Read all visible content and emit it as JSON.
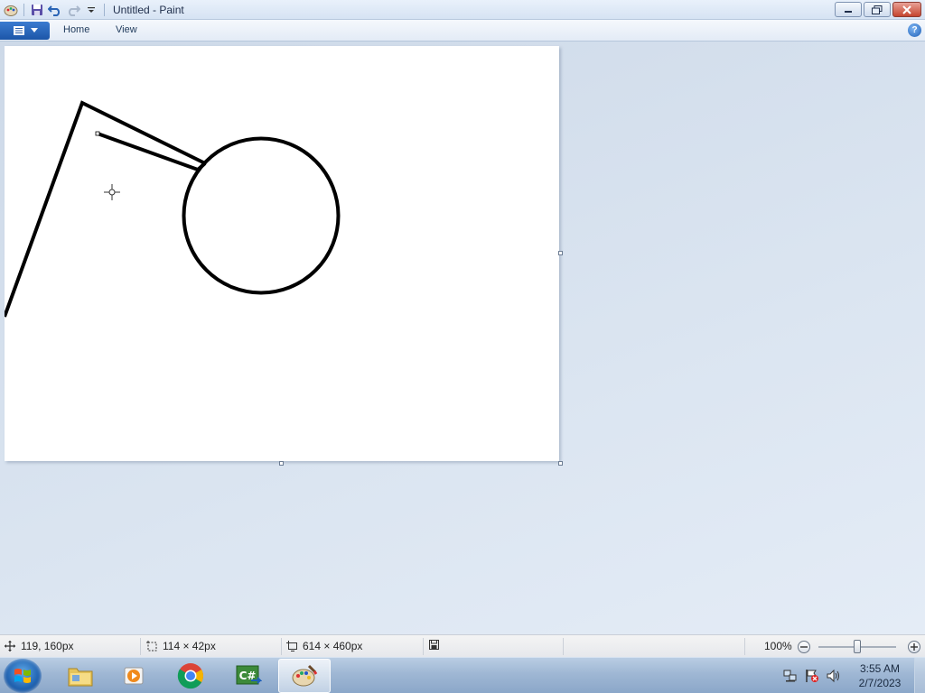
{
  "window": {
    "title": "Untitled - Paint"
  },
  "ribbon": {
    "tabs": [
      "Home",
      "View"
    ],
    "help": "?"
  },
  "status": {
    "cursor_position": "119, 160px",
    "selection_size": "114 × 42px",
    "image_size": "614 × 460px",
    "zoom": "100%"
  },
  "taskbar": {
    "time": "3:55 AM",
    "date": "2/7/2023",
    "apps": [
      "windows-explorer",
      "media-player",
      "chrome",
      "csharp-ide",
      "paint"
    ]
  },
  "colors": {
    "title_gradient_top": "#e9f1fb",
    "app_menu_blue": "#1c56a8",
    "workspace": "#d3deeb",
    "canvas": "#ffffff",
    "stroke": "#000000"
  }
}
